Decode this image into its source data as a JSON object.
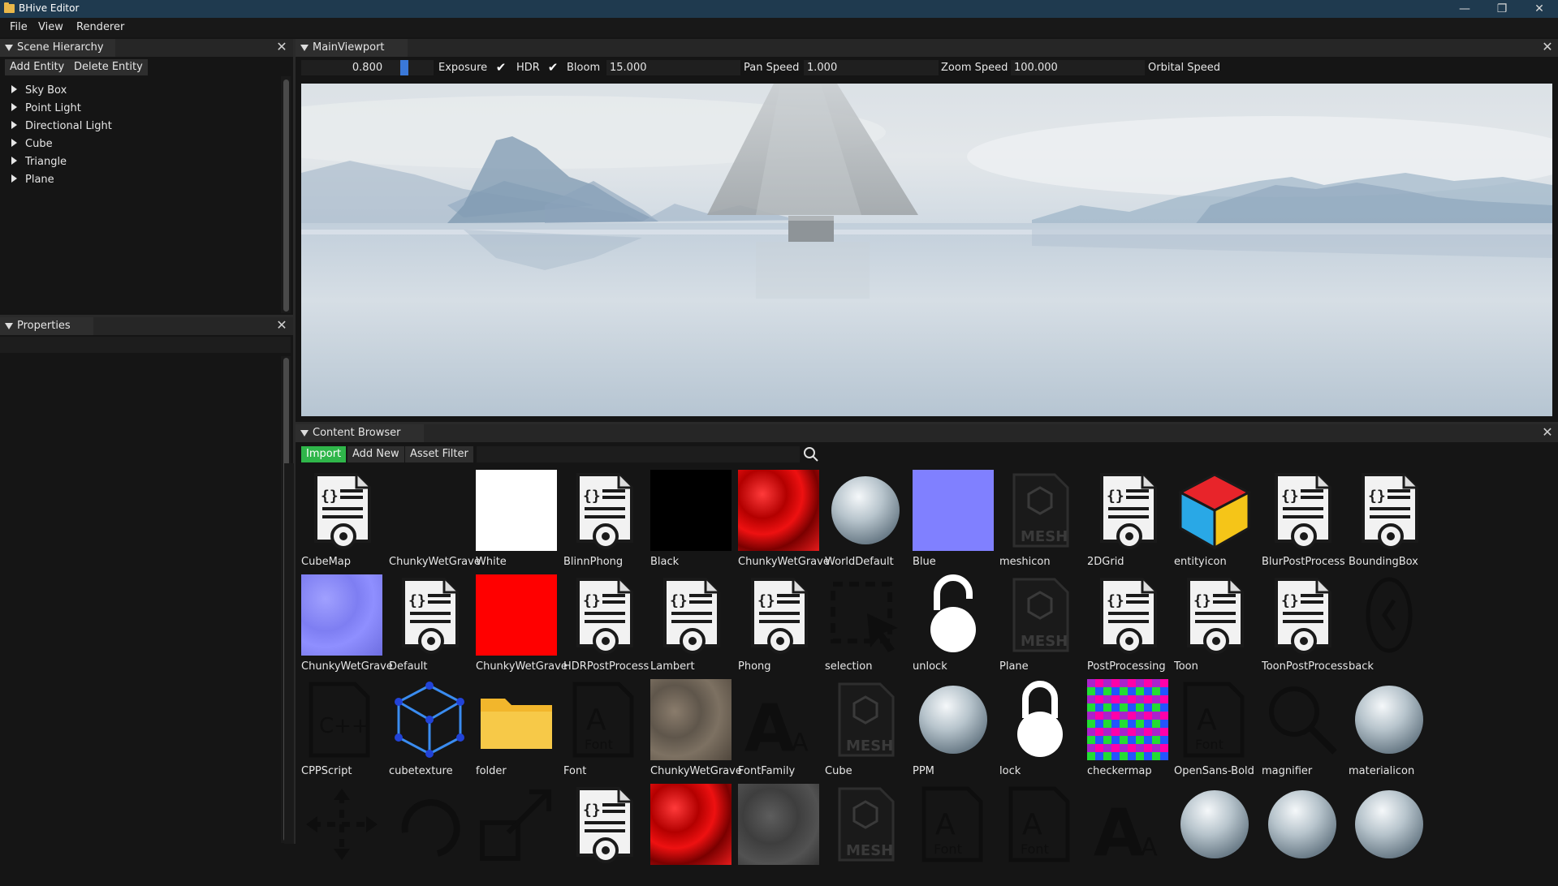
{
  "window": {
    "title": "BHive Editor",
    "controls": [
      "—",
      "❐",
      "✕"
    ]
  },
  "menubar": [
    "File",
    "View",
    "Renderer"
  ],
  "scene_hierarchy": {
    "title": "Scene Hierarchy",
    "add_button": "Add Entity",
    "delete_button": "Delete Entity",
    "entities": [
      "Sky Box",
      "Point Light",
      "Directional Light",
      "Cube",
      "Triangle",
      "Plane"
    ]
  },
  "properties": {
    "title": "Properties"
  },
  "main_viewport": {
    "title": "MainViewport",
    "exposure_value": "0.800",
    "exposure_label": "Exposure",
    "hdr_label": "HDR",
    "hdr_checked": true,
    "bloom_label": "Bloom",
    "bloom_checked": true,
    "pan_speed_value": "15.000",
    "pan_speed_label": "Pan Speed",
    "zoom_speed_value": "1.000",
    "zoom_speed_label": "Zoom Speed",
    "orbital_speed_value": "100.000",
    "orbital_speed_label": "Orbital Speed"
  },
  "content_browser": {
    "title": "Content Browser",
    "import_button": "Import",
    "add_new_button": "Add New",
    "asset_filter_button": "Asset Filter",
    "search_value": "",
    "assets": [
      {
        "name": "CubeMap",
        "kind": "doc"
      },
      {
        "name": "ChunkyWetGravel",
        "kind": "empty"
      },
      {
        "name": "White",
        "kind": "white"
      },
      {
        "name": "BlinnPhong",
        "kind": "doc"
      },
      {
        "name": "Black",
        "kind": "black"
      },
      {
        "name": "ChunkyWetGravel",
        "kind": "red-rock"
      },
      {
        "name": "WorldDefault",
        "kind": "sphere"
      },
      {
        "name": "Blue",
        "kind": "blue"
      },
      {
        "name": "meshicon",
        "kind": "mesh"
      },
      {
        "name": "2DGrid",
        "kind": "doc"
      },
      {
        "name": "entityicon",
        "kind": "entity"
      },
      {
        "name": "BlurPostProcess",
        "kind": "doc"
      },
      {
        "name": "BoundingBox",
        "kind": "doc"
      },
      {
        "name": "ChunkyWetGravel",
        "kind": "normal"
      },
      {
        "name": "Default",
        "kind": "doc"
      },
      {
        "name": "ChunkyWetGravel",
        "kind": "red"
      },
      {
        "name": "HDRPostProcess",
        "kind": "doc"
      },
      {
        "name": "Lambert",
        "kind": "doc"
      },
      {
        "name": "Phong",
        "kind": "doc"
      },
      {
        "name": "selection",
        "kind": "selection"
      },
      {
        "name": "unlock",
        "kind": "unlock"
      },
      {
        "name": "Plane",
        "kind": "mesh"
      },
      {
        "name": "PostProcessing",
        "kind": "doc"
      },
      {
        "name": "Toon",
        "kind": "doc"
      },
      {
        "name": "ToonPostProcess",
        "kind": "doc"
      },
      {
        "name": "back",
        "kind": "back"
      },
      {
        "name": "CPPScript",
        "kind": "cpp"
      },
      {
        "name": "cubetexture",
        "kind": "cubetex"
      },
      {
        "name": "folder",
        "kind": "folder"
      },
      {
        "name": "Font",
        "kind": "font"
      },
      {
        "name": "ChunkyWetGravel",
        "kind": "gravel"
      },
      {
        "name": "FontFamily",
        "kind": "fontfamily"
      },
      {
        "name": "Cube",
        "kind": "mesh"
      },
      {
        "name": "PPM",
        "kind": "sphere"
      },
      {
        "name": "lock",
        "kind": "lock"
      },
      {
        "name": "checkermap",
        "kind": "checker"
      },
      {
        "name": "OpenSans-Bold",
        "kind": "font"
      },
      {
        "name": "magnifier",
        "kind": "magnifier"
      },
      {
        "name": "materialicon",
        "kind": "sphere"
      },
      {
        "name": "",
        "kind": "move"
      },
      {
        "name": "",
        "kind": "rotate"
      },
      {
        "name": "",
        "kind": "scale"
      },
      {
        "name": "",
        "kind": "doc"
      },
      {
        "name": "",
        "kind": "red-rock"
      },
      {
        "name": "",
        "kind": "gray-rock"
      },
      {
        "name": "",
        "kind": "mesh"
      },
      {
        "name": "",
        "kind": "font"
      },
      {
        "name": "",
        "kind": "font"
      },
      {
        "name": "",
        "kind": "fontfamily"
      },
      {
        "name": "",
        "kind": "sphere"
      },
      {
        "name": "",
        "kind": "sphere"
      },
      {
        "name": "",
        "kind": "sphere"
      }
    ]
  }
}
